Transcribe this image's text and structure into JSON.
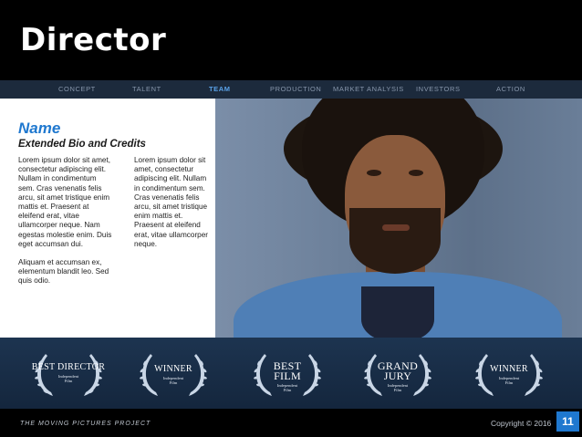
{
  "title": "Director",
  "nav": {
    "items": [
      {
        "label": "CONCEPT"
      },
      {
        "label": "TALENT"
      },
      {
        "label": "TEAM"
      },
      {
        "label": "PRODUCTION"
      },
      {
        "label": "MARKET ANALYSIS"
      },
      {
        "label": "INVESTORS"
      },
      {
        "label": "ACTION"
      }
    ],
    "active": "TEAM",
    "active_color": "#5aa2e8"
  },
  "bio": {
    "name": "Name",
    "subtitle": "Extended Bio and Credits",
    "col1_p1": "Lorem ipsum dolor sit amet, consectetur adipiscing elit. Nullam in condimentum sem. Cras venenatis felis arcu, sit amet tristique enim mattis et. Praesent at eleifend erat, vitae ullamcorper neque. Nam egestas molestie enim. Duis eget accumsan dui.",
    "col1_p2": "Aliquam et accumsan ex, elementum blandit leo. Sed quis odio.",
    "col2": "Lorem ipsum dolor sit amet, consectetur adipiscing elit. Nullam in condimentum sem. Cras venenatis felis arcu, sit amet tristique enim mattis et. Praesent at eleifend erat, vitae ullamcorper neque."
  },
  "awards": [
    {
      "title": "BEST DIRECTOR",
      "subtitle": "Independent Film"
    },
    {
      "title": "WINNER",
      "subtitle": "Independent Film"
    },
    {
      "title": "BEST FILM",
      "subtitle": "Independent Film"
    },
    {
      "title": "GRAND JURY",
      "subtitle": "Independent Film"
    },
    {
      "title": "WINNER",
      "subtitle": "Independent Film"
    }
  ],
  "footer": {
    "left": "THE MOVING PICTURES PROJECT",
    "right": "Copyright © 2016",
    "page_number": "11"
  },
  "colors": {
    "accent": "#1f78cf",
    "nav_bg": "#1c2a3c",
    "awards_bg": "#1d3450"
  },
  "icons": [
    "laurel-wreath-icon"
  ]
}
